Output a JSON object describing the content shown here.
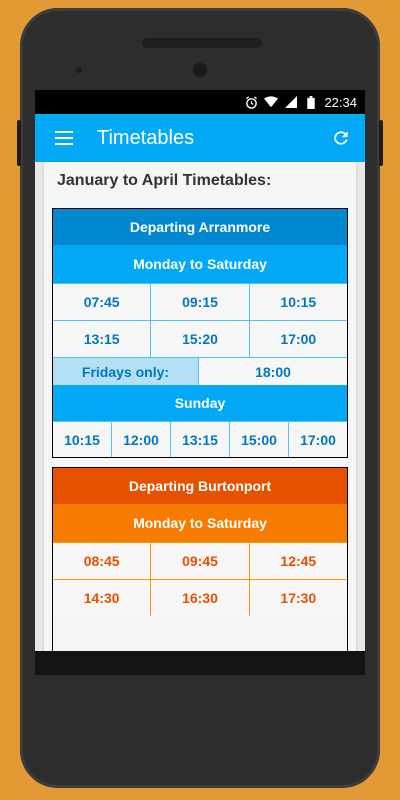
{
  "status_bar": {
    "time": "22:34",
    "icons": [
      "alarm-icon",
      "wifi-icon",
      "signal-icon",
      "battery-icon"
    ]
  },
  "app_bar": {
    "title": "Timetables",
    "menu_icon": "hamburger-menu-icon",
    "action_icon": "refresh-icon"
  },
  "page": {
    "section_title": "January to April Timetables:",
    "arranmore": {
      "title": "Departing Arranmore",
      "mon_sat_label": "Monday to Saturday",
      "mon_sat_times": [
        [
          "07:45",
          "09:15",
          "10:15"
        ],
        [
          "13:15",
          "15:20",
          "17:00"
        ]
      ],
      "fridays_label": "Fridays only:",
      "fridays_time": "18:00",
      "sunday_label": "Sunday",
      "sunday_times": [
        "10:15",
        "12:00",
        "13:15",
        "15:00",
        "17:00"
      ]
    },
    "burtonport": {
      "title": "Departing Burtonport",
      "mon_sat_label": "Monday to Saturday",
      "mon_sat_times": [
        [
          "08:45",
          "09:45",
          "12:45"
        ],
        [
          "14:30",
          "16:30",
          "17:30"
        ]
      ]
    }
  },
  "colors": {
    "background": "#e29b34",
    "app_bar": "#03a9f4",
    "blue_header": "#0288d1",
    "blue_subheader": "#03a9f4",
    "orange_header": "#e65100",
    "orange_subheader": "#f57c00"
  }
}
